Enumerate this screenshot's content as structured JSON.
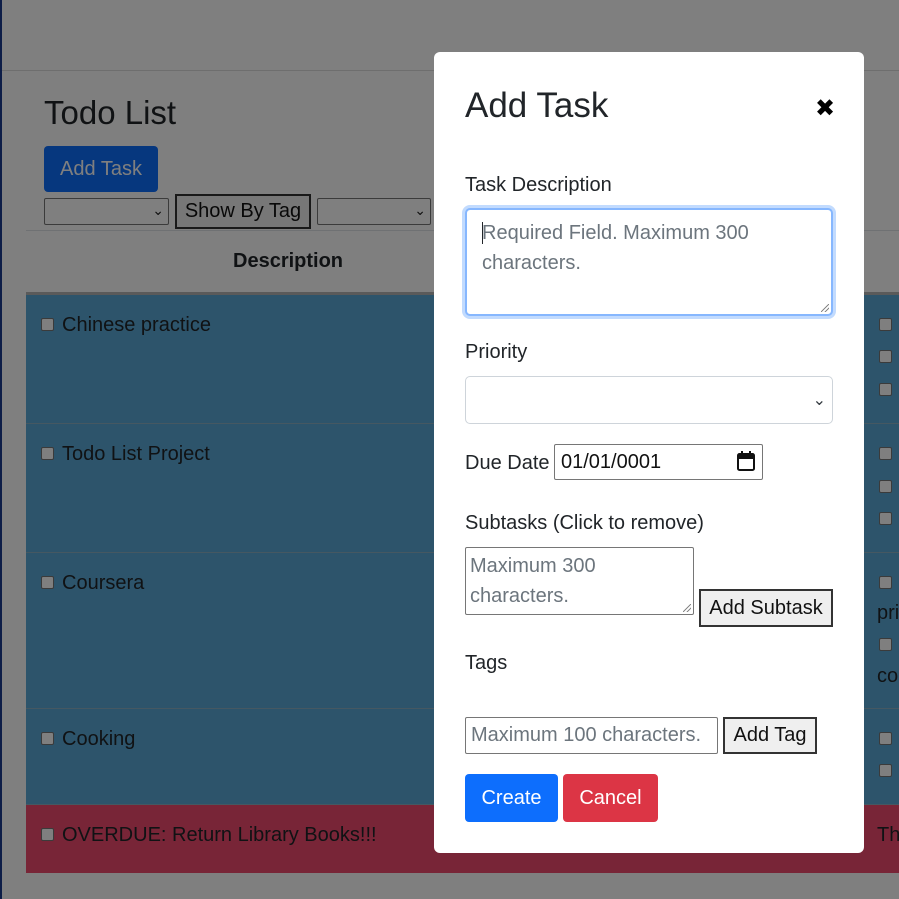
{
  "page": {
    "title": "Todo List",
    "add_task_label": "Add Task",
    "show_by_tag_label": "Show By Tag",
    "table_header_description": "Description"
  },
  "tasks": [
    {
      "description": "Chinese practice",
      "color": "#5aa9d6",
      "right_fragments": [
        "",
        "",
        ""
      ]
    },
    {
      "description": "Todo List Project",
      "color": "#5aa9d6",
      "right_fragments": [
        "",
        "",
        ""
      ]
    },
    {
      "description": "Coursera",
      "color": "#5aa9d6",
      "right_fragments": [
        "",
        "pri",
        "",
        "cor"
      ]
    },
    {
      "description": "Cooking",
      "color": "#5aa9d6",
      "right_fragments": [
        "",
        ""
      ]
    },
    {
      "description": "OVERDUE: Return Library Books!!!",
      "color": "#f04a6e",
      "right_fragments": [
        "Th"
      ]
    }
  ],
  "modal": {
    "title": "Add Task",
    "close_symbol": "✖",
    "task_description_label": "Task Description",
    "task_description_placeholder": "Required Field. Maximum 300 characters.",
    "priority_label": "Priority",
    "priority_selected": "",
    "due_date_label": "Due Date",
    "due_date_value": "01/01/0001",
    "subtasks_label": "Subtasks (Click to remove)",
    "subtask_placeholder": "Maximum 300 characters.",
    "add_subtask_label": "Add Subtask",
    "tags_label": "Tags",
    "tag_placeholder": "Maximum 100 characters.",
    "add_tag_label": "Add Tag",
    "create_label": "Create",
    "cancel_label": "Cancel"
  },
  "colors": {
    "primary": "#0d6efd",
    "danger": "#dc3545",
    "row_blue": "#5aa9d6",
    "row_overdue": "#f04a6e"
  }
}
